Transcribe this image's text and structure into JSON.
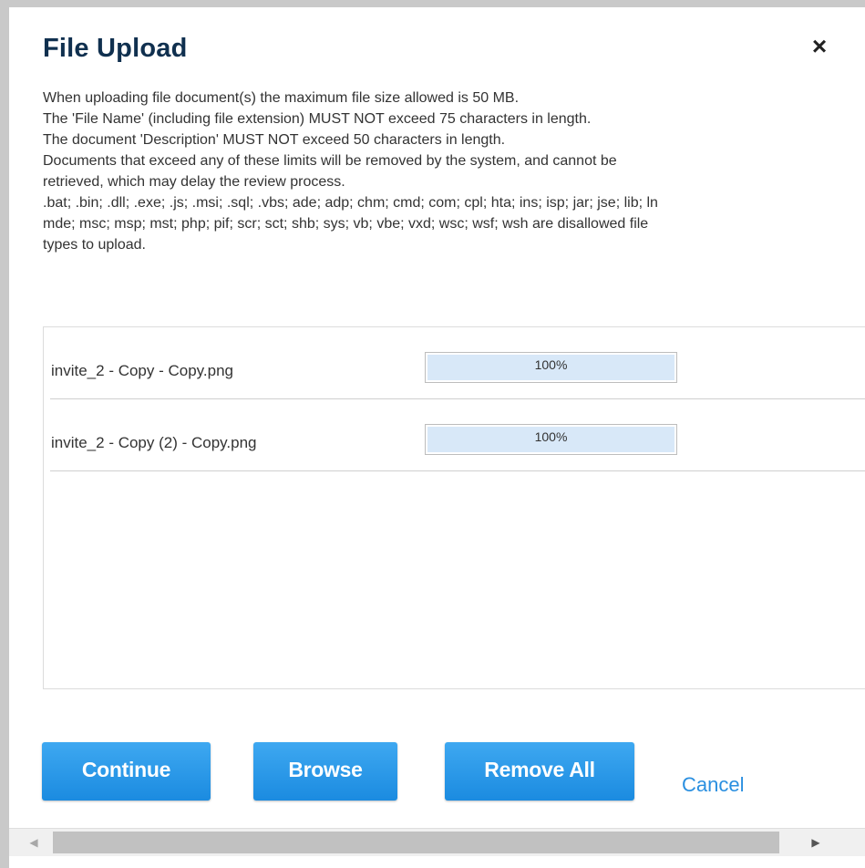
{
  "dialog": {
    "title": "File Upload",
    "close_glyph": "×",
    "close_icon": "close-icon"
  },
  "info": {
    "lines": [
      "When uploading file document(s) the maximum file size allowed is 50 MB.",
      "The 'File Name' (including file extension) MUST NOT exceed 75 characters in length.",
      "The document 'Description' MUST NOT exceed 50 characters in length.",
      "Documents that exceed any of these limits will be removed by the system, and cannot be",
      "retrieved, which may delay the review process.",
      ".bat; .bin; .dll; .exe; .js; .msi; .sql; .vbs; ade; adp; chm; cmd; com; cpl; hta; ins; isp; jar; jse; lib; ln",
      "mde; msc; msp; mst; php; pif; scr; sct; shb; sys; vb; vbe; vxd; wsc; wsf; wsh are disallowed file",
      "types to upload."
    ]
  },
  "files": [
    {
      "name": "invite_2 - Copy - Copy.png",
      "progress_label": "100%",
      "progress": 1.0
    },
    {
      "name": "invite_2 - Copy (2) - Copy.png",
      "progress_label": "100%",
      "progress": 1.0
    }
  ],
  "buttons": {
    "continue": "Continue",
    "browse": "Browse",
    "remove_all": "Remove All",
    "cancel": "Cancel"
  },
  "scrollbar": {
    "left_arrow": "◀",
    "right_arrow": "▶"
  },
  "colors": {
    "title": "#10304f",
    "button": "#2196ea",
    "link": "#2a8fe0",
    "progress_fill": "#d8e8f8"
  }
}
